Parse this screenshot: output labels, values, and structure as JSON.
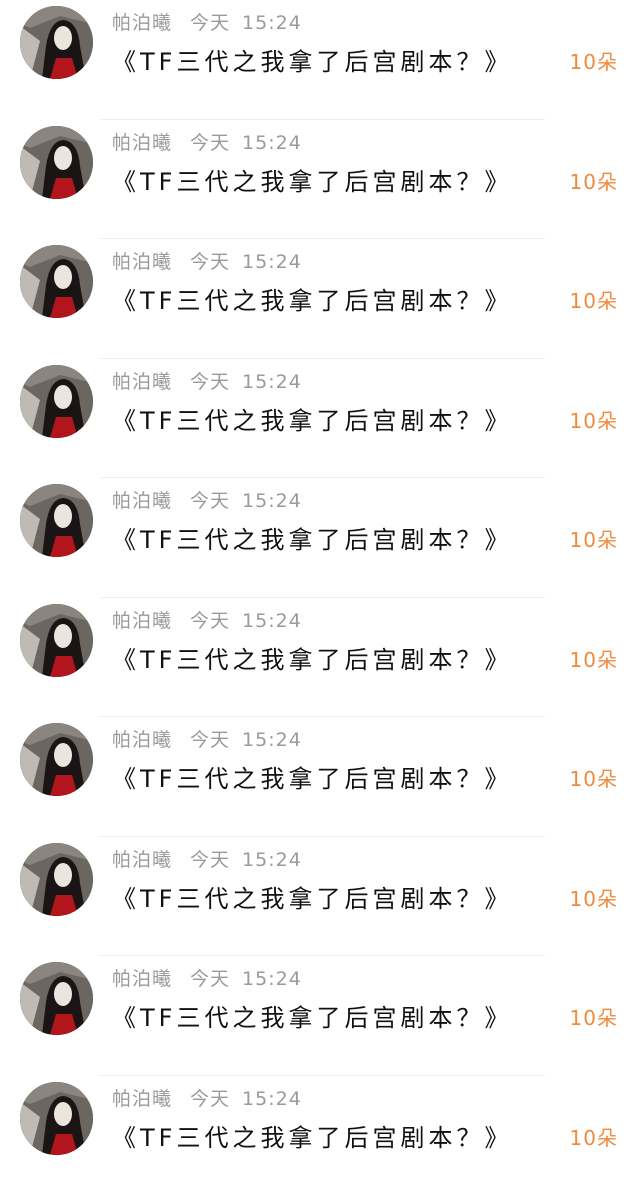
{
  "colors": {
    "reward": "#f08a3c",
    "meta": "#9a9a9a",
    "title": "#111111"
  },
  "items": [
    {
      "author": "帕泊曦",
      "day": "今天",
      "time": "15:24",
      "title": "《TF三代之我拿了后宫剧本？》",
      "reward": "10朵"
    },
    {
      "author": "帕泊曦",
      "day": "今天",
      "time": "15:24",
      "title": "《TF三代之我拿了后宫剧本？》",
      "reward": "10朵"
    },
    {
      "author": "帕泊曦",
      "day": "今天",
      "time": "15:24",
      "title": "《TF三代之我拿了后宫剧本？》",
      "reward": "10朵"
    },
    {
      "author": "帕泊曦",
      "day": "今天",
      "time": "15:24",
      "title": "《TF三代之我拿了后宫剧本？》",
      "reward": "10朵"
    },
    {
      "author": "帕泊曦",
      "day": "今天",
      "time": "15:24",
      "title": "《TF三代之我拿了后宫剧本？》",
      "reward": "10朵"
    },
    {
      "author": "帕泊曦",
      "day": "今天",
      "time": "15:24",
      "title": "《TF三代之我拿了后宫剧本？》",
      "reward": "10朵"
    },
    {
      "author": "帕泊曦",
      "day": "今天",
      "time": "15:24",
      "title": "《TF三代之我拿了后宫剧本？》",
      "reward": "10朵"
    },
    {
      "author": "帕泊曦",
      "day": "今天",
      "time": "15:24",
      "title": "《TF三代之我拿了后宫剧本？》",
      "reward": "10朵"
    },
    {
      "author": "帕泊曦",
      "day": "今天",
      "time": "15:24",
      "title": "《TF三代之我拿了后宫剧本？》",
      "reward": "10朵"
    },
    {
      "author": "帕泊曦",
      "day": "今天",
      "time": "15:24",
      "title": "《TF三代之我拿了后宫剧本？》",
      "reward": "10朵"
    }
  ]
}
